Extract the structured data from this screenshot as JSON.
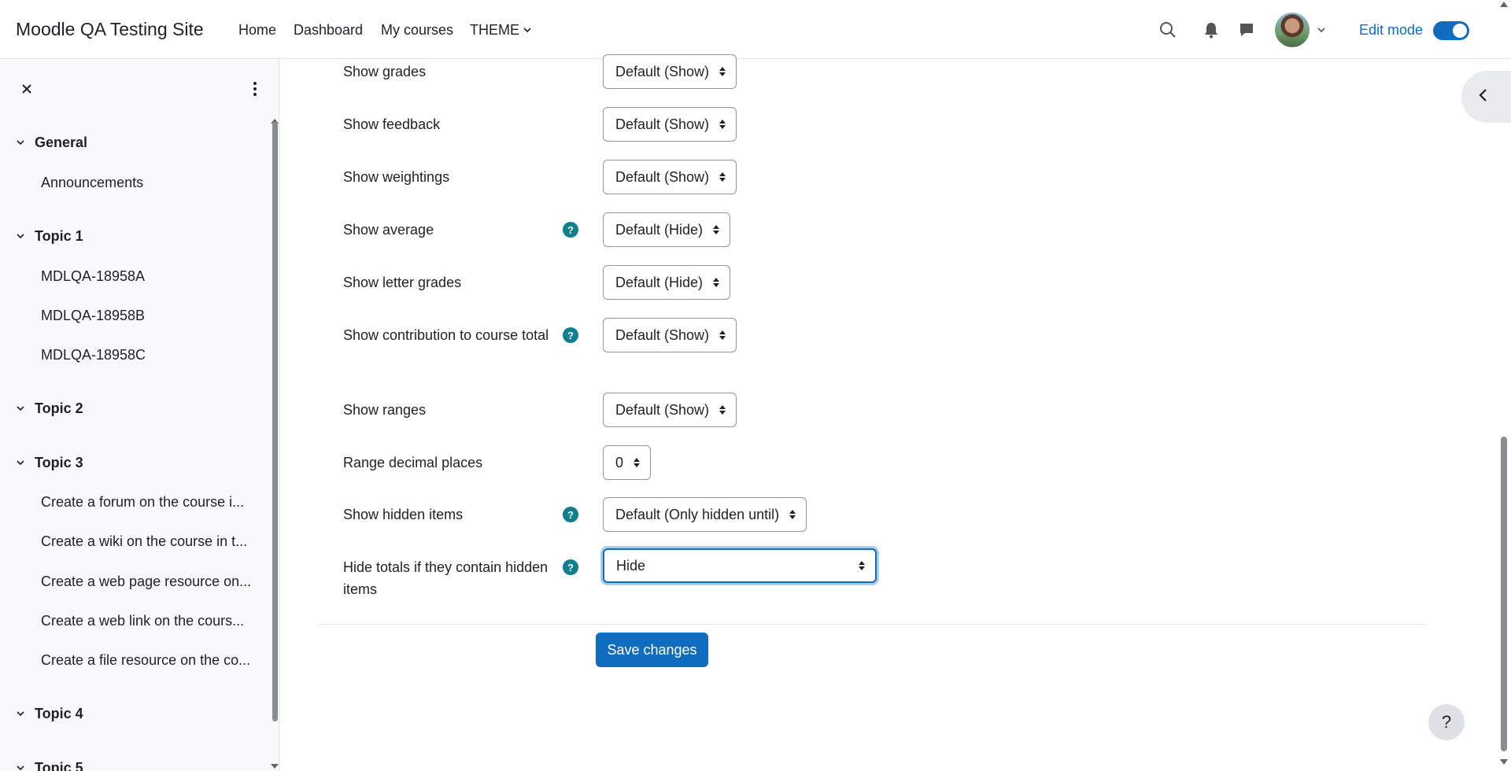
{
  "site": {
    "name": "Moodle QA Testing Site"
  },
  "nav": {
    "home": "Home",
    "dashboard": "Dashboard",
    "my_courses": "My courses",
    "theme": "THEME",
    "edit_mode": "Edit mode"
  },
  "drawer": {
    "sections": [
      {
        "title": "General",
        "items": [
          "Announcements"
        ]
      },
      {
        "title": "Topic 1",
        "items": [
          "MDLQA-18958A",
          "MDLQA-18958B",
          "MDLQA-18958C"
        ]
      },
      {
        "title": "Topic 2",
        "items": []
      },
      {
        "title": "Topic 3",
        "items": [
          "Create a forum on the course i...",
          "Create a wiki on the course in t...",
          "Create a web page resource on...",
          "Create a web link on the cours...",
          "Create a file resource on the co..."
        ]
      },
      {
        "title": "Topic 4",
        "items": []
      },
      {
        "title": "Topic 5",
        "items": []
      }
    ]
  },
  "form": {
    "fields": [
      {
        "label": "Show grades",
        "value": "Default (Show)"
      },
      {
        "label": "Show feedback",
        "value": "Default (Show)"
      },
      {
        "label": "Show weightings",
        "value": "Default (Show)"
      },
      {
        "label": "Show average",
        "value": "Default (Hide)"
      },
      {
        "label": "Show letter grades",
        "value": "Default (Hide)"
      },
      {
        "label": "Show contribution to course total",
        "value": "Default (Show)"
      },
      {
        "label": "Show ranges",
        "value": "Default (Show)"
      },
      {
        "label": "Range decimal places",
        "value": "0"
      },
      {
        "label": "Show hidden items",
        "value": "Default (Only hidden until)"
      },
      {
        "label": "Hide totals if they contain hidden items",
        "value": "Hide"
      }
    ],
    "help_symbol": "?",
    "save_label": "Save changes"
  },
  "help_fab": "?",
  "colors": {
    "primary": "#0f6cbf",
    "help_icon": "#0f7f8e"
  }
}
